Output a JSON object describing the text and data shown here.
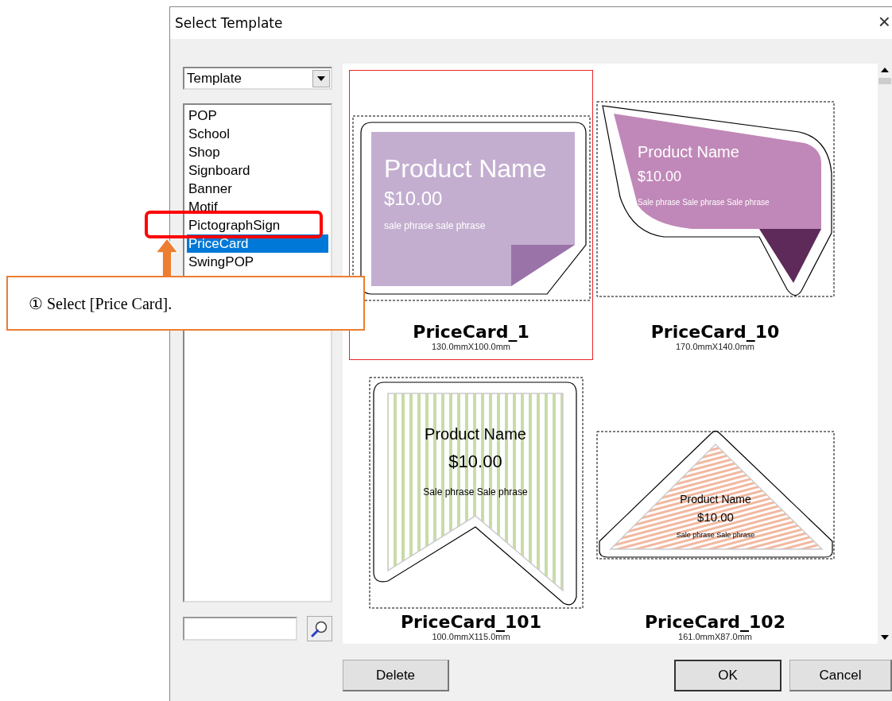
{
  "window": {
    "title": "Select Template",
    "close": "×"
  },
  "category_dropdown": {
    "value": "Template"
  },
  "categories": [
    {
      "label": "POP",
      "selected": false
    },
    {
      "label": "School",
      "selected": false
    },
    {
      "label": "Shop",
      "selected": false
    },
    {
      "label": "Signboard",
      "selected": false
    },
    {
      "label": "Banner",
      "selected": false
    },
    {
      "label": "Motif",
      "selected": false
    },
    {
      "label": "PictographSign",
      "selected": false
    },
    {
      "label": "PriceCard",
      "selected": true
    },
    {
      "label": "SwingPOP",
      "selected": false
    }
  ],
  "templates": [
    {
      "kind": "note",
      "name": "PriceCard_1",
      "size": "130.0mmX100.0mm",
      "selected": true,
      "product": "Product Name",
      "price": "$10.00",
      "phrase": "sale phrase sale phrase"
    },
    {
      "kind": "speech",
      "name": "PriceCard_10",
      "size": "170.0mmX140.0mm",
      "selected": false,
      "product": "Product Name",
      "price": "$10.00",
      "phrase": "Sale phrase Sale phrase Sale phrase"
    },
    {
      "kind": "banner",
      "name": "PriceCard_101",
      "size": "100.0mmX115.0mm",
      "selected": false,
      "product": "Product Name",
      "price": "$10.00",
      "phrase": "Sale phrase Sale phrase"
    },
    {
      "kind": "triangle",
      "name": "PriceCard_102",
      "size": "161.0mmX87.0mm",
      "selected": false,
      "product": "Product Name",
      "price": "$10.00",
      "phrase": "Sale phrase Sale phrase"
    }
  ],
  "buttons": [
    {
      "label": "Delete",
      "default": false
    },
    {
      "label": "OK",
      "default": true
    },
    {
      "label": "Cancel",
      "default": false
    }
  ],
  "annotation": {
    "text": "① Select [Price Card]."
  }
}
